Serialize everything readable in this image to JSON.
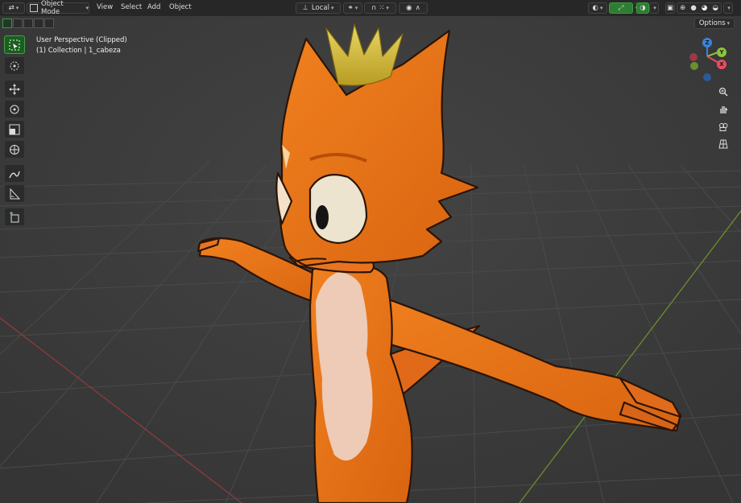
{
  "header": {
    "mode": "Object Mode",
    "menus": [
      "View",
      "Select",
      "Add",
      "Object"
    ],
    "orientation": "Local"
  },
  "overlay": {
    "line1": "User Perspective (Clipped)",
    "line2": "(1) Collection | 1_cabeza"
  },
  "options_label": "Options",
  "gizmo": {
    "z": "Z",
    "y": "Y",
    "x": "X"
  },
  "toolbar": {
    "tools": [
      "select-box",
      "cursor",
      "move",
      "rotate",
      "scale",
      "transform",
      "annotate",
      "measure",
      "add-cube"
    ]
  },
  "colors": {
    "accent_green": "#3c9a41",
    "axis_x": "#e84d5f",
    "axis_y": "#8cc43c",
    "axis_z": "#3b82d9",
    "character_orange": "#e8731e",
    "crown_gold": "#d6bd3c"
  }
}
